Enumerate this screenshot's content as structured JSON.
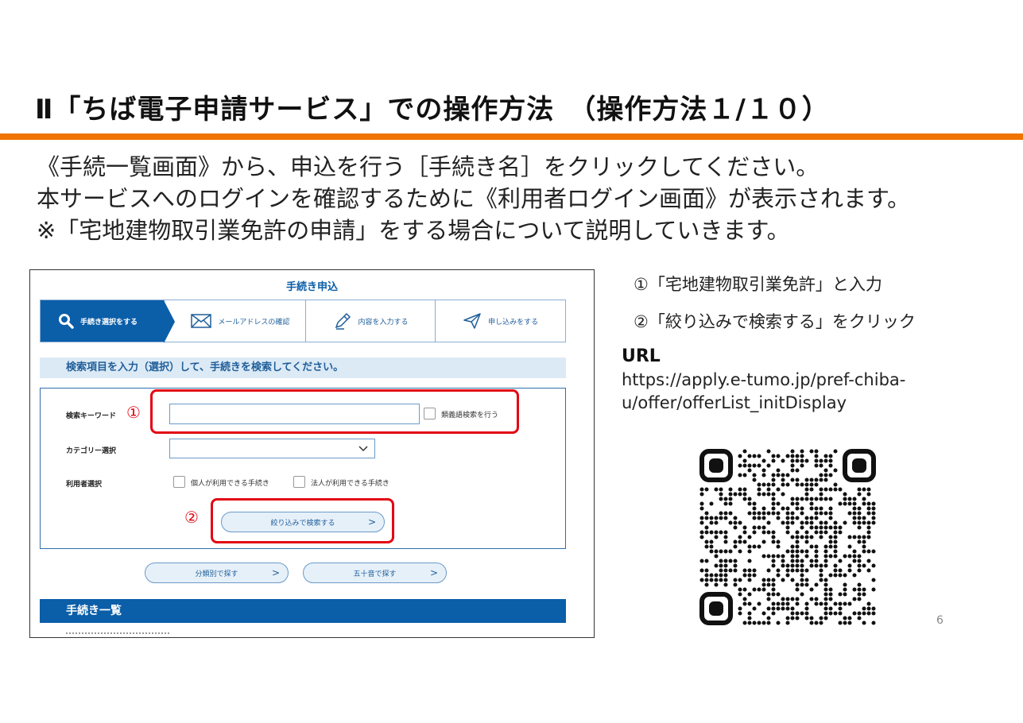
{
  "slide": {
    "title": "Ⅱ「ちば電子申請サービス」での操作方法　（操作方法１/１０）",
    "intro": [
      "《手続一覧画面》から、申込を行う［手続き名］をクリックしてください。",
      "本サービスへのログインを確認するために《利用者ログイン画面》が表示されます。",
      "※「宅地建物取引業免許の申請」をする場合について説明していきます。"
    ],
    "page_number": "6",
    "accent_color": "#f07400"
  },
  "screenshot": {
    "title": "手続き申込",
    "steps": [
      "手続き選択をする",
      "メールアドレスの確認",
      "内容を入力する",
      "申し込みをする"
    ],
    "heading": "検索項目を入力（選択）して、手続きを検索してください。",
    "keyword_label": "検索キーワード",
    "keyword_value": "",
    "synonym_label": "類義語検索を行う",
    "category_label": "カテゴリー選択",
    "category_value": "",
    "user_label": "利用者選択",
    "personal_label": "個人が利用できる手続き",
    "corporate_label": "法人が利用できる手続き",
    "search_button": "絞り込みで検索する",
    "category_button": "分類別で探す",
    "kana_button": "五十音で探す",
    "arrow": ">",
    "list_heading": "手続き一覧",
    "marker_1": "①",
    "marker_2": "②",
    "primary_color": "#0b5ea8",
    "highlight_color": "#e30613"
  },
  "notes": [
    "①「宅地建物取引業免許」と入力",
    "②「絞り込みで検索する」をクリック"
  ],
  "url": {
    "label": "URL",
    "lines": [
      "https://apply.e-tumo.jp/pref-chiba-",
      "u/offer/offerList_initDisplay"
    ]
  }
}
